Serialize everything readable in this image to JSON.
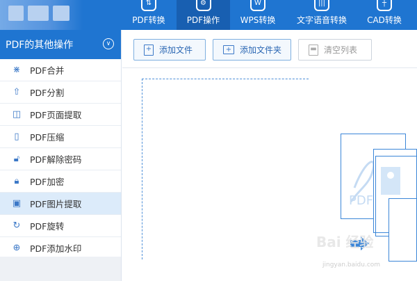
{
  "nav": [
    {
      "label": "PDF转换",
      "icon": "pdf-convert-icon"
    },
    {
      "label": "PDF操作",
      "icon": "gear-icon",
      "active": true
    },
    {
      "label": "WPS转换",
      "icon": "wps-icon"
    },
    {
      "label": "文字语音转换",
      "icon": "voice-icon"
    },
    {
      "label": "CAD转换",
      "icon": "cad-icon"
    }
  ],
  "sidebar": {
    "title": "PDF的其他操作",
    "items": [
      {
        "label": "PDF合并",
        "icon": "merge-icon"
      },
      {
        "label": "PDF分割",
        "icon": "split-icon"
      },
      {
        "label": "PDF页面提取",
        "icon": "page-extract-icon"
      },
      {
        "label": "PDF压缩",
        "icon": "compress-icon"
      },
      {
        "label": "PDF解除密码",
        "icon": "unlock-icon"
      },
      {
        "label": "PDF加密",
        "icon": "lock-icon"
      },
      {
        "label": "PDF图片提取",
        "icon": "image-icon",
        "active": true
      },
      {
        "label": "PDF旋转",
        "icon": "rotate-icon"
      },
      {
        "label": "PDF添加水印",
        "icon": "watermark-icon"
      }
    ]
  },
  "toolbar": {
    "add_file": "添加文件",
    "add_folder": "添加文件夹",
    "clear_list": "清空列表"
  },
  "illustration": {
    "pdf_text": "PDF"
  },
  "watermark": {
    "main": "Bai 经验",
    "sub": "jingyan.baidu.com"
  },
  "colors": {
    "accent": "#1f75d1",
    "active_nav": "#185fb1",
    "active_item": "#dcebfa"
  }
}
